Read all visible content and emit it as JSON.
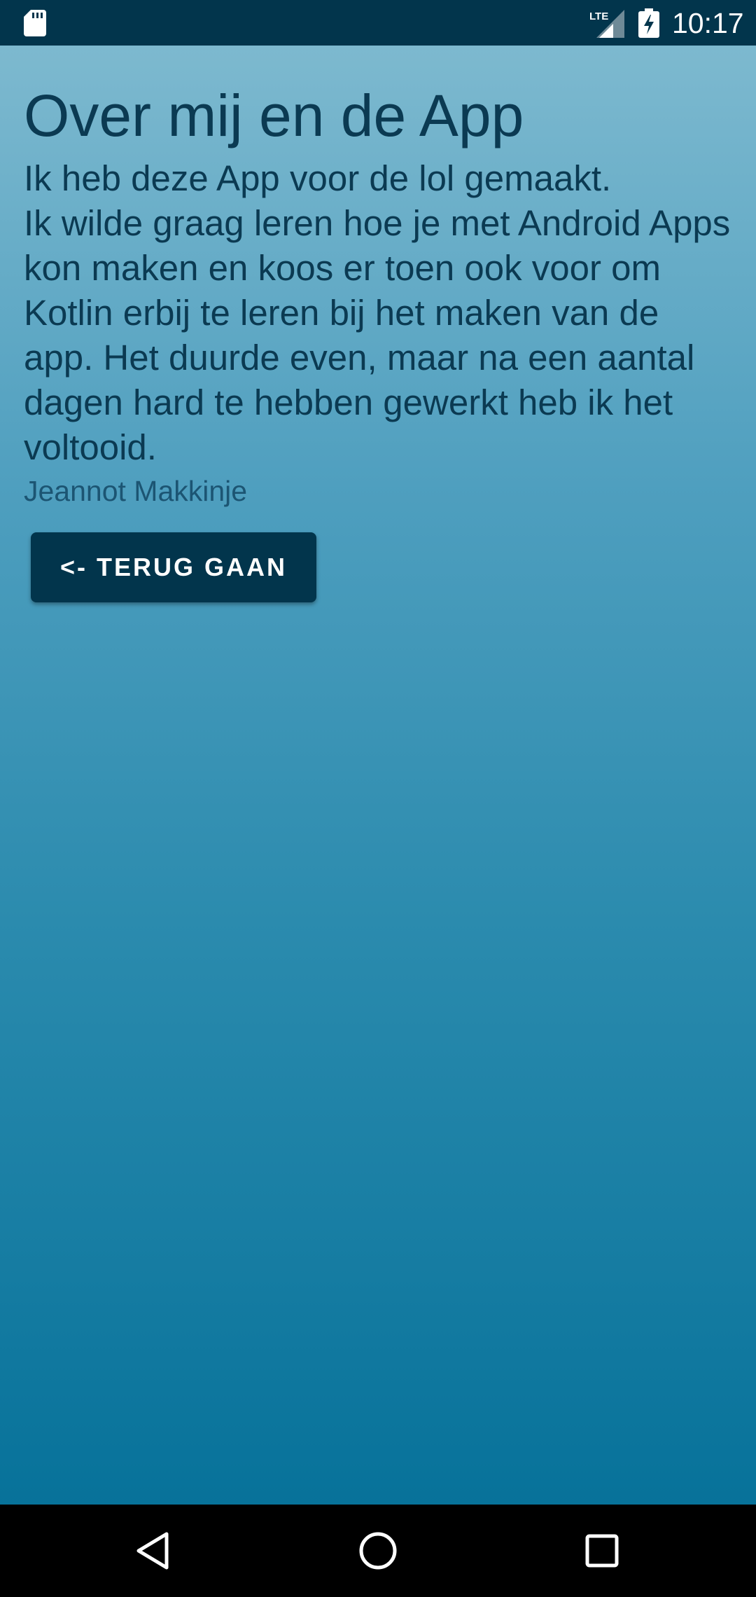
{
  "status_bar": {
    "time": "10:17",
    "network": "LTE",
    "icons": [
      "sd-card-icon",
      "lte-signal-icon",
      "battery-charging-icon"
    ]
  },
  "page": {
    "title": "Over mij en de App",
    "body_lines": [
      "Ik heb deze App voor de lol gemaakt.",
      "Ik wilde graag leren hoe je met Android Apps kon maken en koos er toen ook voor om Kotlin erbij te leren bij het maken van de app. Het duurde even, maar na een aantal dagen hard te hebben gewerkt heb ik het voltooid."
    ],
    "author": "Jeannot Makkinje",
    "back_button_label": "<- TERUG GAAN"
  },
  "nav_bar": {
    "icons": [
      "nav-back-icon",
      "nav-home-icon",
      "nav-recents-icon"
    ]
  },
  "colors": {
    "status_bar": "#02354c",
    "gradient_top": "#7db9cf",
    "gradient_bottom": "#07729a",
    "text": "#0b3a52",
    "button": "#02354c"
  }
}
